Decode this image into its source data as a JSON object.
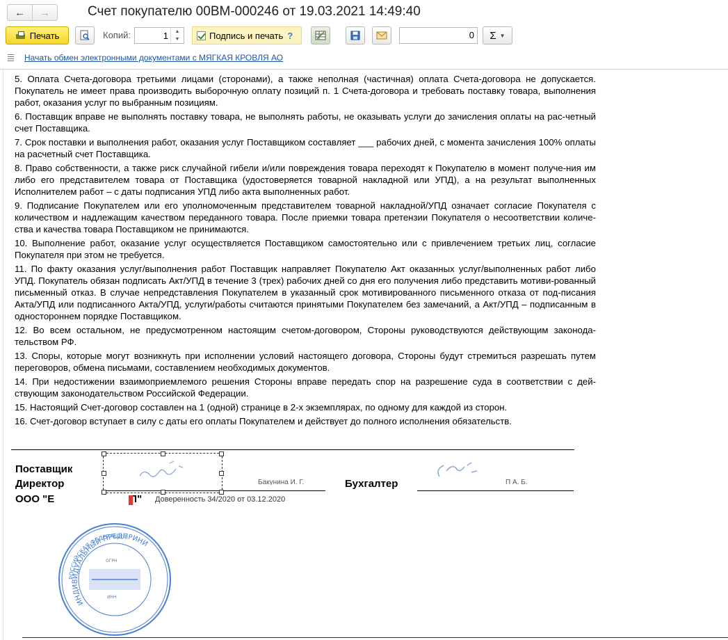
{
  "window": {
    "title": "Счет покупателю 00ВМ-000246 от 19.03.2021 14:49:40"
  },
  "toolbar": {
    "print_label": "Печать",
    "copies_label": "Копий:",
    "copies_value": "1",
    "sign_print_label": "Подпись и печать",
    "help_label": "?",
    "sum_value": "0",
    "sigma_label": "Σ"
  },
  "edi": {
    "link_text": "Начать обмен электронными документами с МЯГКАЯ КРОВЛЯ АО"
  },
  "document": {
    "terms": [
      "5.  Оплата Счета-договора третьими лицами (сторонами), а также неполная (частичная) оплата Счета-договора не допускается. Покупатель не имеет права производить выборочную оплату позиций п. 1 Счета-договора и требовать поставку товара, выполнения работ, оказания услуг по выбранным позициям.",
      "6.  Поставщик вправе не выполнять поставку товара, не выполнять работы, не оказывать услуги до зачисления оплаты на рас-четный счет Поставщика.",
      "7.   Срок поставки и выполнения работ, оказания услуг Поставщиком составляет ___ рабочих дней, с момента зачисления 100% оплаты на расчетный счет Поставщика.",
      "8.  Право собственности, а также риск случайной гибели и/или повреждения товара переходят к Покупателю в момент получе-ния им либо его представителем товара от Поставщика (удостоверяется товарной накладной или УПД), а на результат выполненных Исполнителем работ – с даты подписания УПД либо акта выполненных работ.",
      "9.  Подписание Покупателем или его уполномоченным представителем товарной накладной/УПД означает согласие Покупателя с количеством и надлежащим качеством переданного товара. После приемки товара претензии Покупателя о несоответствии количе-ства и качества товара Поставщиком не принимаются.",
      "10. Выполнение работ, оказание услуг осуществляется Поставщиком самостоятельно или с привлечением третьих лиц, согласие Покупателя при этом не требуется.",
      "11. По факту оказания услуг/выполнения работ Поставщик направляет Покупателю Акт оказанных услуг/выполненных работ либо УПД. Покупатель обязан подписать Акт/УПД в течение 3 (трех) рабочих дней со дня его получения либо представить мотиви-рованный письменный отказ. В случае непредставления Покупателем в указанный срок мотивированного письменного отказа от под-писания Акта/УПД или подписанного Акта/УПД, услуги/работы считаются принятыми Покупателем без замечаний, а Акт/УПД – подписанным в одностороннем порядке Поставщиком.",
      "12. Во всем остальном, не предусмотренном настоящим счетом-договором, Стороны руководствуются действующим законода-тельством РФ.",
      "13. Споры, которые могут возникнуть при исполнении условий настоящего договора, Стороны будут стремиться разрешать путем переговоров, обмена письмами, составлением необходимых документов.",
      "14. При недостижении взаимоприемлемого решения Стороны вправе передать спор на разрешение суда в соответствии с дей-ствующим законодательством Российской Федерации.",
      "15. Настоящий Счет-договор составлен на 1 (одной) странице в 2-х экземплярах, по одному для каждой из сторон.",
      "16. Счет-договор вступает в силу с даты его оплаты Покупателем и действует до полного исполнения обязательств."
    ],
    "supplier_label": "Поставщик",
    "director_label": "Директор",
    "org_label": "ООО \"Е",
    "org_tail": "П\"",
    "accountant_label": "Бухгалтер",
    "power_of_attorney": "Доверенность 34/2020 от 03.12.2020",
    "director_name_partial": "Бакунина И. Г.",
    "accountant_name_partial": "П А. Б.",
    "stamp_top_text": "РОССИЙСКАЯ ФЕДЕРАЦИЯ",
    "stamp_side_text": "ИНДИВИДУАЛЬНЫЙ ПРЕДПРИНИМАТЕЛЬ",
    "stamp_ogrn": "ОГРН",
    "stamp_inn": "ИНН"
  },
  "colors": {
    "print_button": "#f5d52a",
    "sign_highlight": "#fdf3c0",
    "link": "#1c55b0",
    "stamp": "#4a7fd8"
  }
}
